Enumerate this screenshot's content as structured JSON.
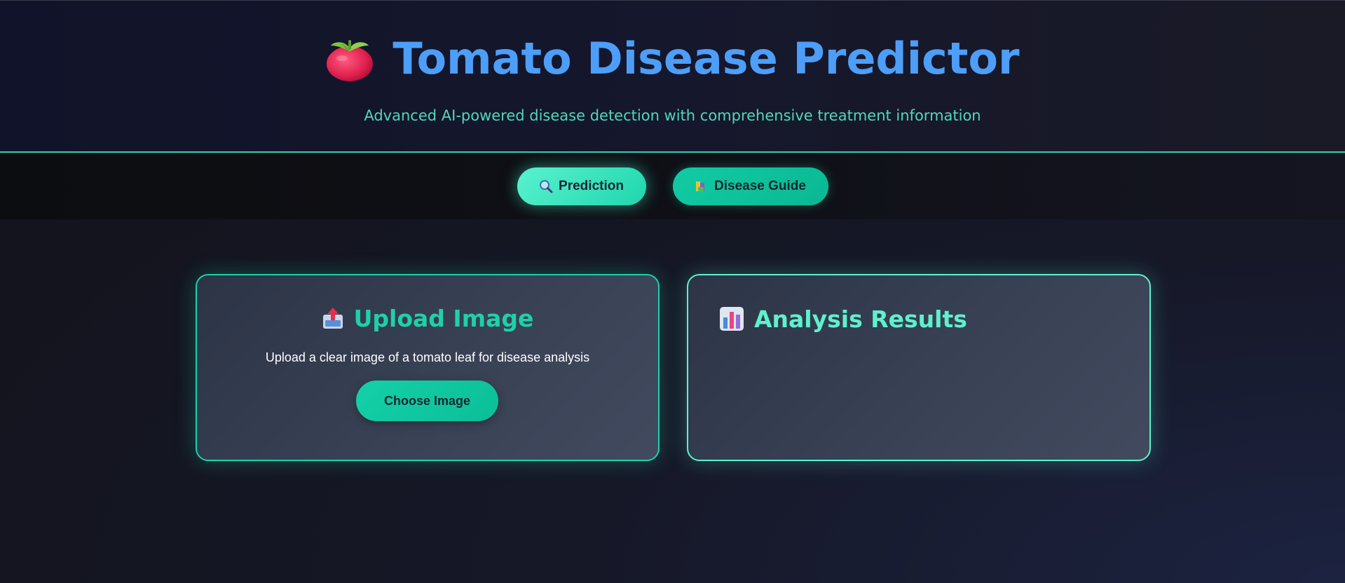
{
  "header": {
    "title": "Tomato Disease Predictor",
    "subtitle": "Advanced AI-powered disease detection with comprehensive treatment information",
    "logo_icon": "tomato-icon"
  },
  "nav": {
    "tabs": [
      {
        "label": "Prediction",
        "icon": "magnifier-icon",
        "active": true
      },
      {
        "label": "Disease Guide",
        "icon": "books-icon",
        "active": false
      }
    ]
  },
  "upload_card": {
    "title": "Upload Image",
    "icon": "outbox-tray-icon",
    "description": "Upload a clear image of a tomato leaf for disease analysis",
    "button_label": "Choose Image"
  },
  "results_card": {
    "title": "Analysis Results",
    "icon": "bar-chart-icon"
  },
  "colors": {
    "title_blue": "#4d9ef8",
    "accent_teal": "#1fd0a8",
    "accent_mint": "#5ff0cf"
  }
}
